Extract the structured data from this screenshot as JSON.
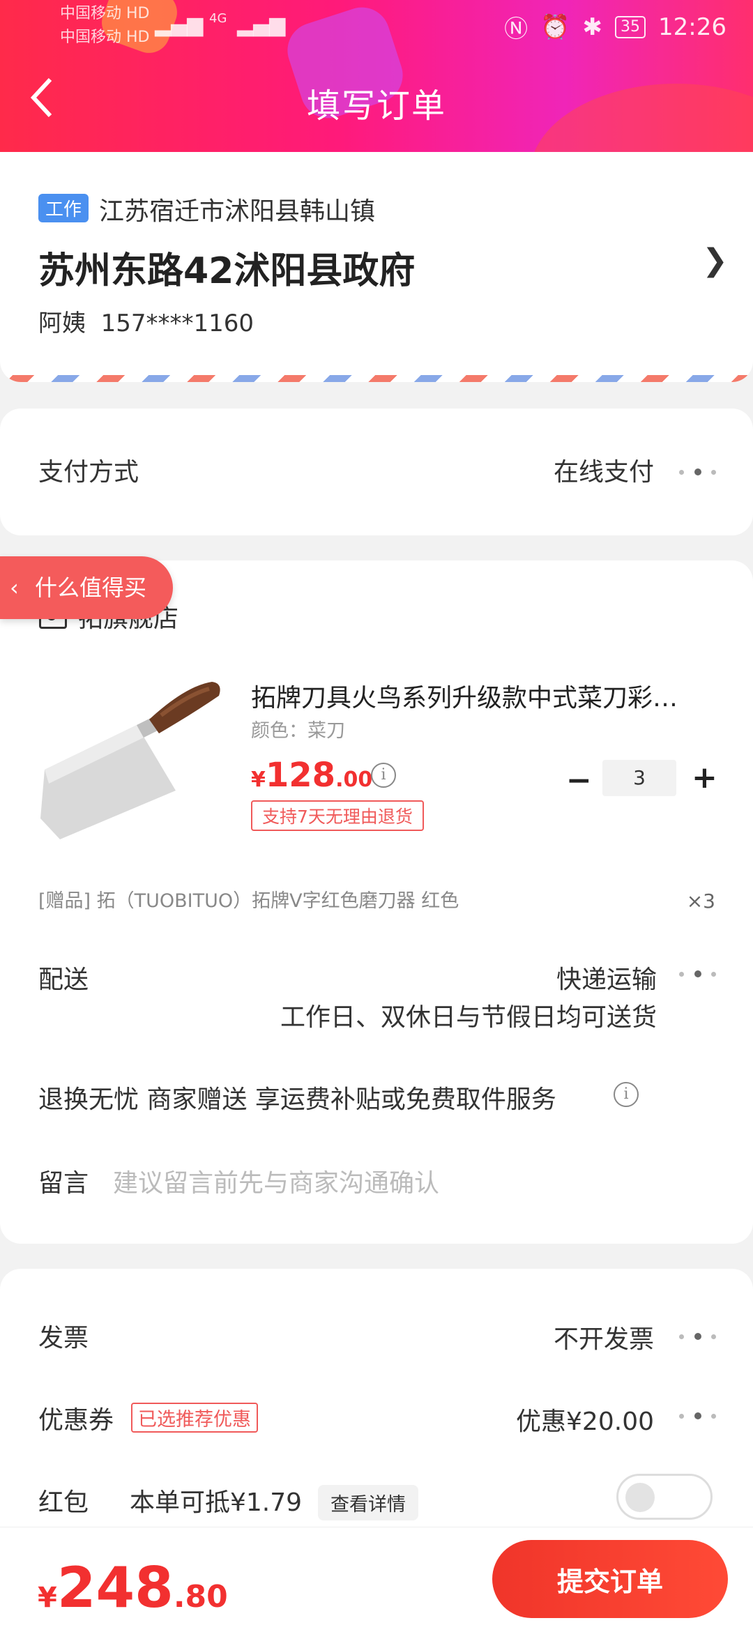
{
  "status_bar": {
    "carrier1": "中国移动",
    "carrier1_tag": "HD",
    "carrier2": "中国移动",
    "carrier2_tag": "HD",
    "network": "4G",
    "battery": "35",
    "time": "12:26"
  },
  "header": {
    "title": "填写订单",
    "back_icon": "chevron-left-icon"
  },
  "address": {
    "tag": "工作",
    "region": "江苏宿迁市沭阳县韩山镇",
    "detail": "苏州东路42沭阳县政府",
    "name": "阿姨",
    "phone": "157****1160"
  },
  "payment": {
    "label": "支付方式",
    "value": "在线支付"
  },
  "float_tag": {
    "label": "什么值得买"
  },
  "shop": {
    "name": "拓旗舰店"
  },
  "product": {
    "title": "拓牌刀具火鸟系列升级款中式菜刀彩…",
    "spec": "颜色：菜刀",
    "price_currency": "¥",
    "price_int": "128",
    "price_dec": ".00",
    "return_policy": "支持7天无理由退货",
    "quantity": "3",
    "minus": "−",
    "plus": "+"
  },
  "gift": {
    "text": "[赠品]  拓（TUOBITUO）拓牌V字红色磨刀器 红色",
    "qty": "×3"
  },
  "delivery": {
    "label": "配送",
    "value": "快递运输",
    "note": "工作日、双休日与节假日均可送货"
  },
  "service": {
    "text": "退换无忧 商家赠送  享运费补贴或免费取件服务"
  },
  "message": {
    "label": "留言",
    "placeholder": "建议留言前先与商家沟通确认"
  },
  "invoice": {
    "label": "发票",
    "value": "不开发票"
  },
  "coupon": {
    "label": "优惠券",
    "tag": "已选推荐优惠",
    "value": "优惠¥20.00"
  },
  "redpacket": {
    "label": "红包",
    "deduct": "本单可抵¥1.79",
    "detail_btn": "查看详情",
    "enabled": false
  },
  "footer": {
    "currency": "¥",
    "total_int": "248",
    "total_dec": ".80",
    "submit": "提交订单"
  },
  "colors": {
    "accent_red": "#f23030",
    "tag_blue": "#4a90f0",
    "header_gradient": [
      "#ff2a4a",
      "#f025b8"
    ]
  }
}
